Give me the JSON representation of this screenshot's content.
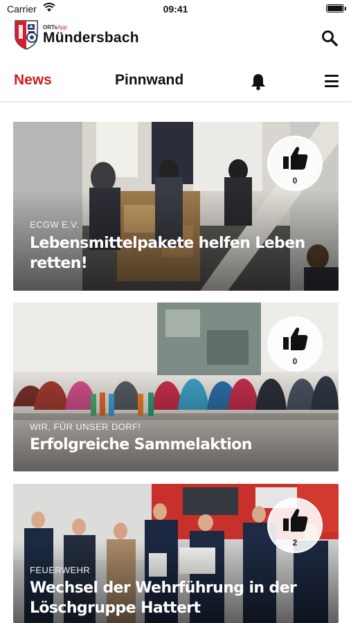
{
  "status_bar": {
    "carrier": "Carrier",
    "time": "09:41"
  },
  "header": {
    "brand_prefix": "ORTs",
    "brand_suffix": "App",
    "title": "Mündersbach"
  },
  "tabs": {
    "news": "News",
    "pinnwand": "Pinnwand"
  },
  "icons": [
    "wifi-icon",
    "battery-icon",
    "crest-logo",
    "search-icon",
    "bell-icon",
    "menu-icon",
    "thumbs-up-icon"
  ],
  "colors": {
    "accent": "#cc1f1f",
    "text": "#111111",
    "divider": "#e6e6e6"
  },
  "articles": [
    {
      "category": "ECGW E.V.",
      "title": "Lebensmittelpakete helfen Leben retten!",
      "likes": "0"
    },
    {
      "category": "WIR, FÜR UNSER DORF!",
      "title": "Erfolgreiche Sammelaktion",
      "likes": "0"
    },
    {
      "category": "FEUERWEHR",
      "title": "Wechsel der Wehrführung in der Löschgruppe Hattert",
      "likes": "2"
    }
  ]
}
